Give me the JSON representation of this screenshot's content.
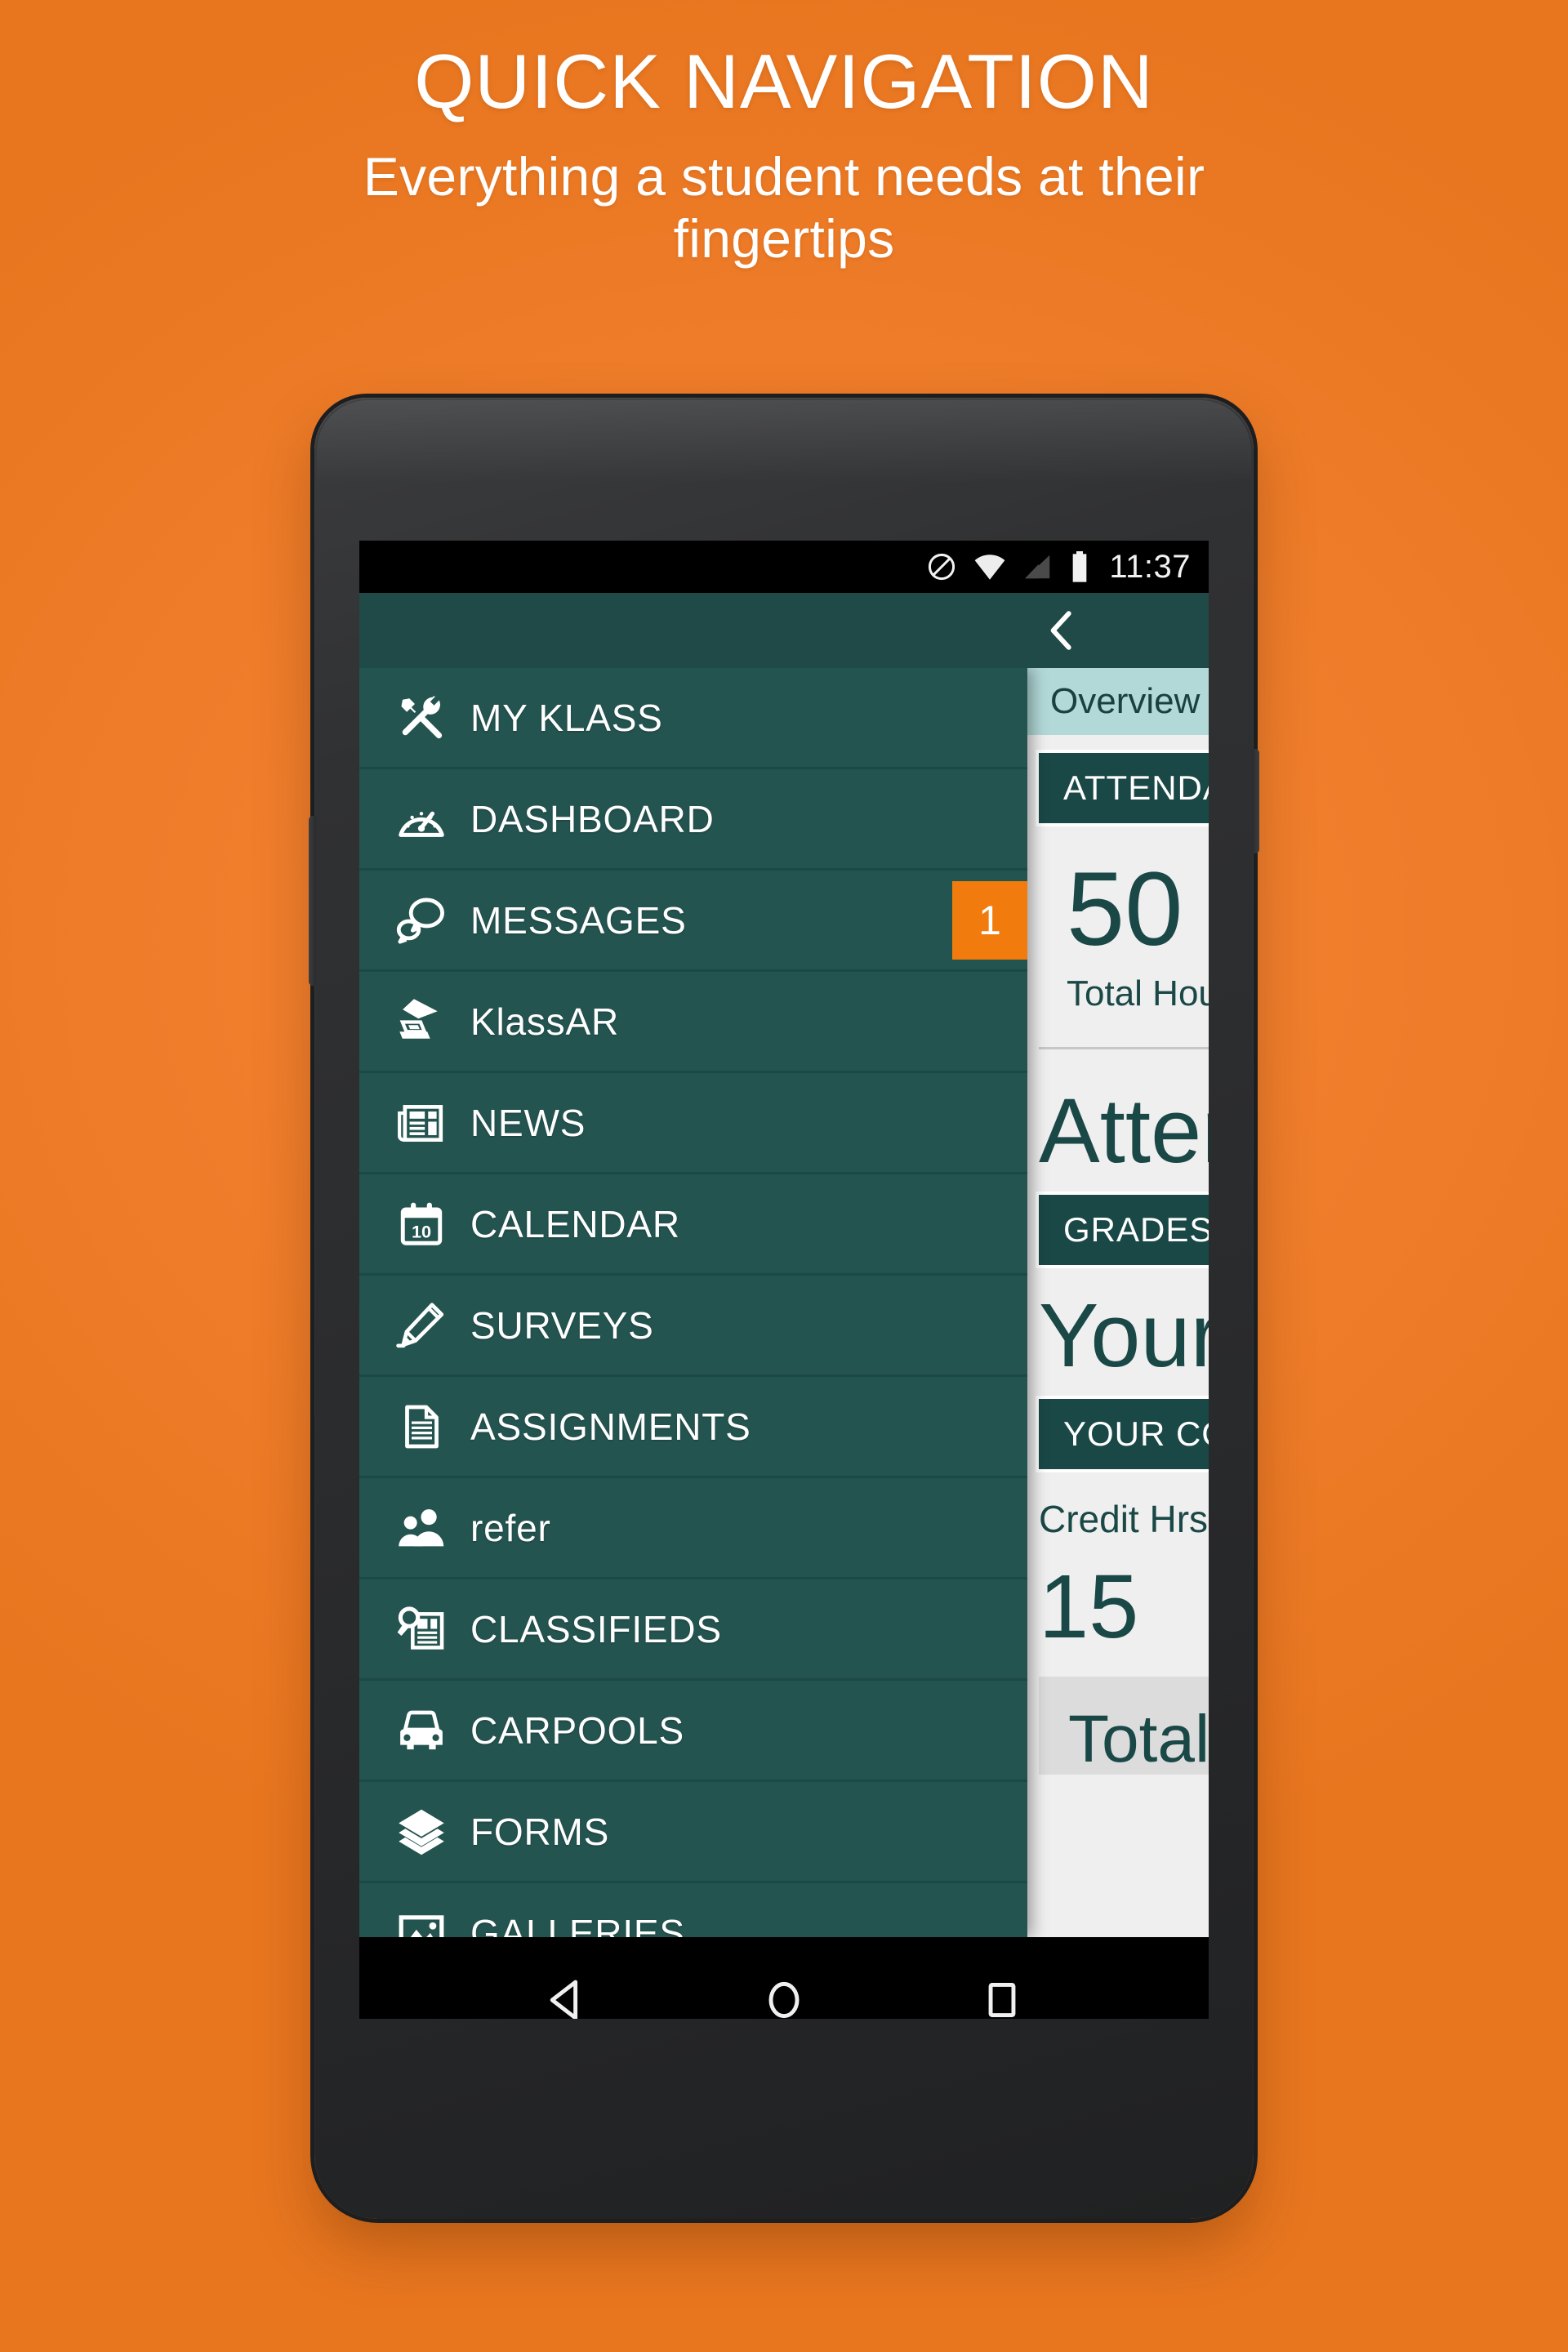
{
  "hero": {
    "title": "QUICK NAVIGATION",
    "subtitle": "Everything a student needs at their fingertips"
  },
  "colors": {
    "background_orange": "#EF7E2A",
    "drawer_teal": "#245450",
    "appbar_teal": "#1F4A47",
    "accent_orange": "#F17C0D",
    "tab_light_teal": "#B2D9D8",
    "content_bg": "#EFEFEF",
    "dark_teal_text": "#1A4846"
  },
  "statusbar": {
    "time": "11:37",
    "icons": [
      "do-not-disturb-icon",
      "wifi-icon",
      "cellular-signal-icon",
      "battery-icon"
    ]
  },
  "appbar": {
    "back_icon": "chevron-left-icon"
  },
  "drawer": {
    "items": [
      {
        "label": "MY KLASS",
        "icon": "tools-icon",
        "badge": null
      },
      {
        "label": "DASHBOARD",
        "icon": "gauge-icon",
        "badge": null
      },
      {
        "label": "MESSAGES",
        "icon": "chat-bubbles-icon",
        "badge": "1"
      },
      {
        "label": "KlassAR",
        "icon": "scanner-icon",
        "badge": null
      },
      {
        "label": "NEWS",
        "icon": "newspaper-icon",
        "badge": null
      },
      {
        "label": "CALENDAR",
        "icon": "calendar-icon",
        "badge": null
      },
      {
        "label": "SURVEYS",
        "icon": "pencil-icon",
        "badge": null
      },
      {
        "label": "ASSIGNMENTS",
        "icon": "document-icon",
        "badge": null
      },
      {
        "label": "refer",
        "icon": "people-icon",
        "badge": null
      },
      {
        "label": "CLASSIFIEDS",
        "icon": "search-news-icon",
        "badge": null
      },
      {
        "label": "CARPOOLS",
        "icon": "car-icon",
        "badge": null
      },
      {
        "label": "FORMS",
        "icon": "layers-icon",
        "badge": null
      },
      {
        "label": "GALLERIES",
        "icon": "photo-icon",
        "badge": null
      }
    ]
  },
  "page": {
    "tab_label": "Overview",
    "attendance_header": "ATTENDANCE",
    "attendance_value": "50",
    "attendance_value_label": "Total Hours",
    "attendance_title": "Attendance",
    "grades_header": "GRADES",
    "grades_title": "Your",
    "courses_header": "YOUR COURSES",
    "credit_hrs_label": "Credit Hrs",
    "credit_hrs_value": "15",
    "total_label": "Total"
  },
  "navbar": {
    "items": [
      {
        "name": "back-nav-icon"
      },
      {
        "name": "home-nav-icon"
      },
      {
        "name": "recents-nav-icon"
      }
    ]
  }
}
